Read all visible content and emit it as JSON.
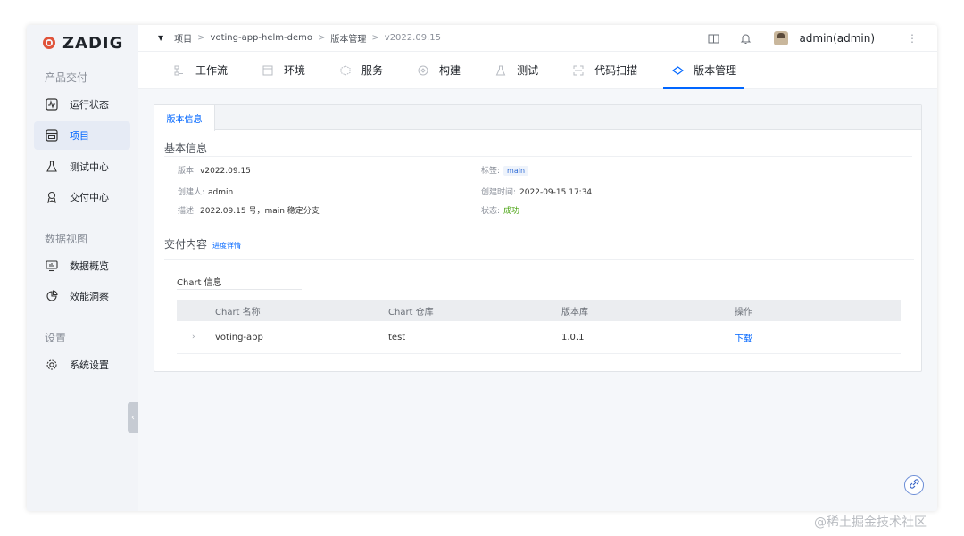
{
  "brand": {
    "name": "ZADIG"
  },
  "sidebar": {
    "groups": [
      {
        "label": "产品交付",
        "items": [
          {
            "label": "运行状态",
            "icon": "pulse-icon"
          },
          {
            "label": "项目",
            "icon": "project-icon",
            "active": true
          },
          {
            "label": "测试中心",
            "icon": "flask-icon"
          },
          {
            "label": "交付中心",
            "icon": "delivery-icon"
          }
        ]
      },
      {
        "label": "数据视图",
        "items": [
          {
            "label": "数据概览",
            "icon": "monitor-icon"
          },
          {
            "label": "效能洞察",
            "icon": "pie-chart-icon"
          }
        ]
      },
      {
        "label": "设置",
        "items": [
          {
            "label": "系统设置",
            "icon": "gear-icon"
          }
        ]
      }
    ]
  },
  "breadcrumb": [
    "项目",
    "voting-app-helm-demo",
    "版本管理",
    "v2022.09.15"
  ],
  "breadcrumb_sep": ">",
  "user": {
    "name": "admin(admin)"
  },
  "tabs": [
    {
      "label": "工作流",
      "icon": "workflow-icon"
    },
    {
      "label": "环境",
      "icon": "environment-icon"
    },
    {
      "label": "服务",
      "icon": "service-icon"
    },
    {
      "label": "构建",
      "icon": "build-icon"
    },
    {
      "label": "测试",
      "icon": "test-icon"
    },
    {
      "label": "代码扫描",
      "icon": "scan-icon"
    },
    {
      "label": "版本管理",
      "icon": "version-icon",
      "active": true
    }
  ],
  "panel": {
    "tab_label": "版本信息",
    "basic_title": "基本信息",
    "version": {
      "label": "版本:",
      "value": "v2022.09.15"
    },
    "tag": {
      "label": "标签:",
      "value": "main"
    },
    "creator": {
      "label": "创建人:",
      "value": "admin"
    },
    "created_at": {
      "label": "创建时间:",
      "value": "2022-09-15 17:34"
    },
    "desc": {
      "label": "描述:",
      "value": "2022.09.15 号，main 稳定分支"
    },
    "status": {
      "label": "状态:",
      "value": "成功"
    },
    "delivery_title": "交付内容",
    "progress_link": "进度详情",
    "chart_section": "Chart 信息",
    "table": {
      "headers": [
        "Chart 名称",
        "Chart 仓库",
        "版本库",
        "操作"
      ],
      "rows": [
        {
          "name": "voting-app",
          "repo": "test",
          "version": "1.0.1",
          "action": "下载"
        }
      ]
    }
  },
  "watermark": "@稀土掘金技术社区",
  "colors": {
    "accent": "#0066ff",
    "success": "#44a10a",
    "brand": "#e0533a"
  }
}
